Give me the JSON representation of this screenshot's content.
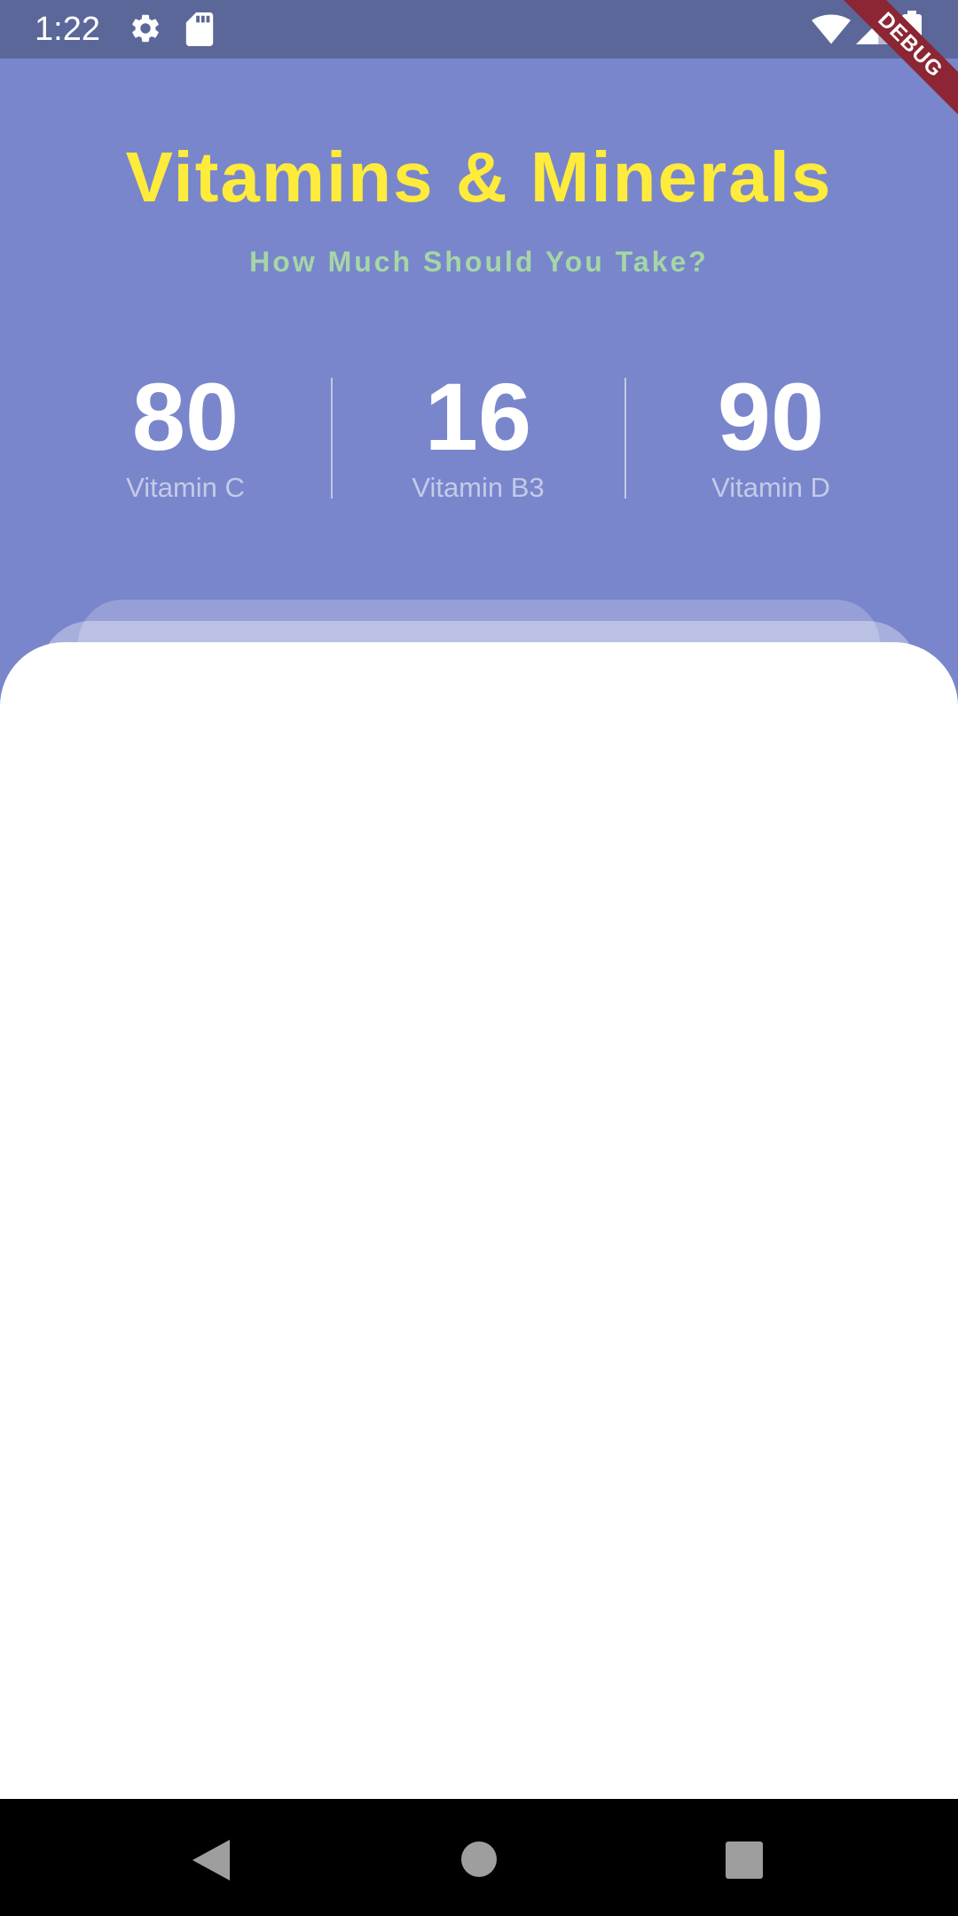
{
  "status_bar": {
    "time": "1:22",
    "icons": [
      "settings-icon",
      "sdcard-icon",
      "wifi-icon",
      "signal-icon",
      "battery-icon"
    ]
  },
  "debug_banner": {
    "label": "DEBUG",
    "color": "#8c2634"
  },
  "header": {
    "title": "Vitamins & Minerals",
    "subtitle": "How Much Should You Take?"
  },
  "stats": [
    {
      "value": "80",
      "label": "Vitamin C"
    },
    {
      "value": "16",
      "label": "Vitamin B3"
    },
    {
      "value": "90",
      "label": "Vitamin D"
    }
  ],
  "colors": {
    "background": "#7986cb",
    "status_bar": "#5c6799",
    "title": "#ffeb3b",
    "subtitle": "#a5d6a7",
    "stat_value": "#ffffff",
    "stat_label": "#c5cae9",
    "card": "#ffffff",
    "nav_bar": "#000000"
  },
  "nav_bar": {
    "buttons": [
      "back-icon",
      "home-icon",
      "recents-icon"
    ]
  }
}
